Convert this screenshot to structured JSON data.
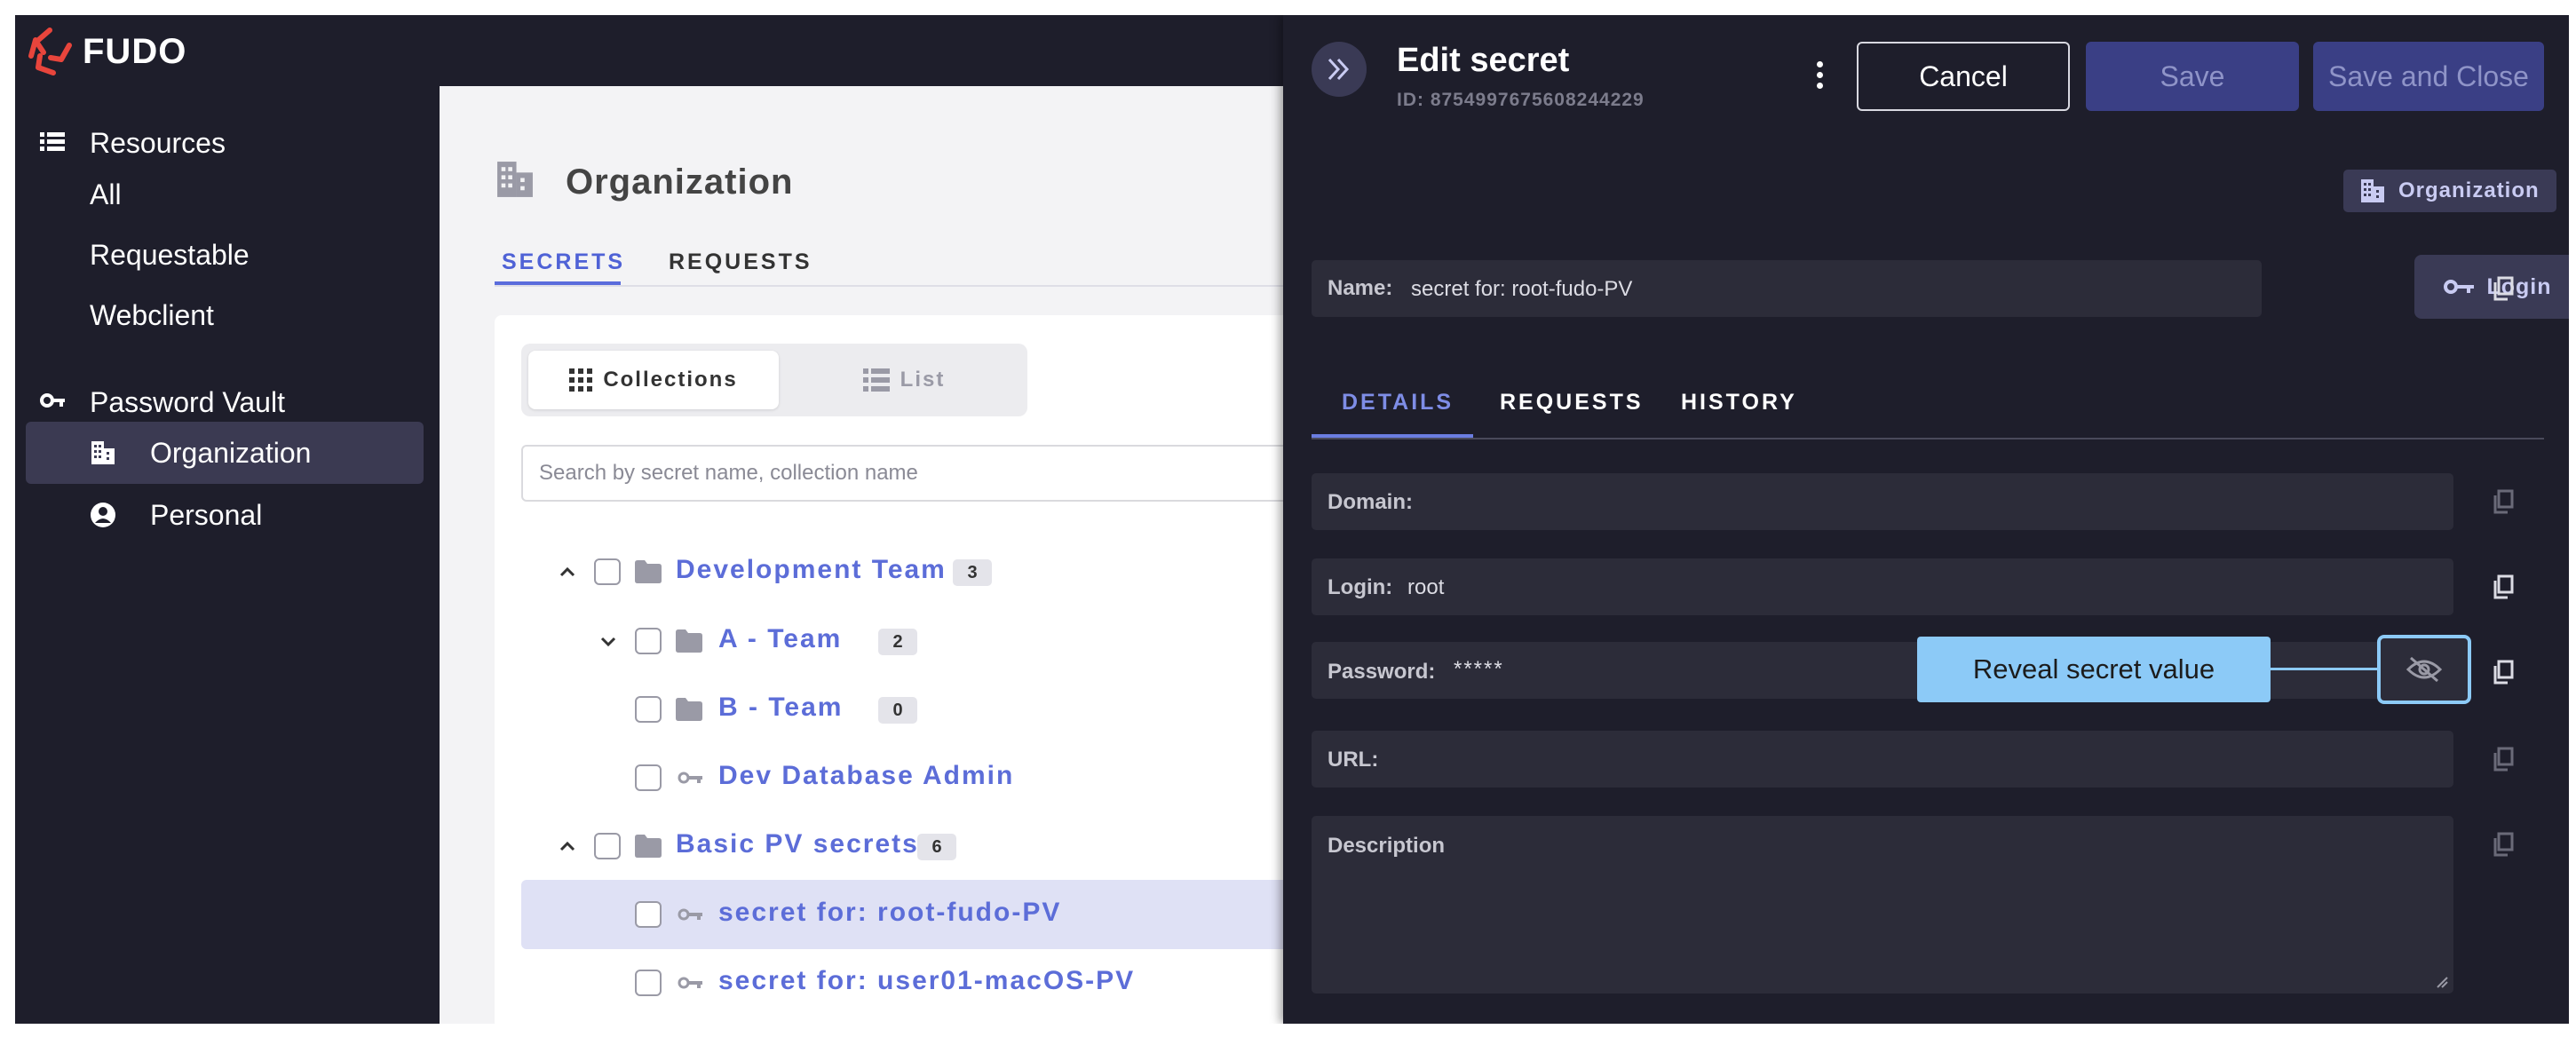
{
  "app": {
    "logo_text": "FUDO",
    "brand_color": "#e8453c"
  },
  "sidebar": {
    "resources_label": "Resources",
    "resources_items": [
      "All",
      "Requestable",
      "Webclient"
    ],
    "vault_label": "Password Vault",
    "vault_items": [
      {
        "label": "Organization",
        "icon": "building-icon",
        "active": true
      },
      {
        "label": "Personal",
        "icon": "user-circle-icon",
        "active": false
      }
    ]
  },
  "main": {
    "title": "Organization",
    "tabs": [
      {
        "label": "SECRETS",
        "active": true
      },
      {
        "label": "REQUESTS",
        "active": false
      }
    ],
    "view_toggle": {
      "collections_label": "Collections",
      "list_label": "List",
      "selected": "Collections"
    },
    "search": {
      "placeholder": "Search by secret name, collection name",
      "value": ""
    },
    "tree": [
      {
        "label": "Development Team",
        "type": "collection",
        "count": "3",
        "level": 0,
        "expanded": true
      },
      {
        "label": "A - Team",
        "type": "collection",
        "count": "2",
        "level": 1,
        "expanded": true
      },
      {
        "label": "B - Team",
        "type": "collection",
        "count": "0",
        "level": 1,
        "expanded": false
      },
      {
        "label": "Dev Database Admin",
        "type": "secret",
        "level": 1
      },
      {
        "label": "Basic PV secrets",
        "type": "collection",
        "count": "6",
        "level": 0,
        "expanded": true
      },
      {
        "label": "secret for: root-fudo-PV",
        "type": "secret",
        "level": 1,
        "selected": true
      },
      {
        "label": "secret for: user01-macOS-PV",
        "type": "secret",
        "level": 1
      }
    ]
  },
  "drawer": {
    "title": "Edit secret",
    "id_text": "ID: 8754997675608244229",
    "cancel_label": "Cancel",
    "save_label": "Save",
    "save_close_label": "Save and Close",
    "org_badge": "Organization",
    "name_label": "Name:",
    "name_value": "secret for: root-fudo-PV",
    "login_button_label": "Login",
    "tabs": [
      {
        "label": "DETAILS",
        "active": true
      },
      {
        "label": "REQUESTS",
        "active": false
      },
      {
        "label": "HISTORY",
        "active": false
      }
    ],
    "fields": {
      "domain_label": "Domain:",
      "domain_value": "",
      "login_label": "Login:",
      "login_value": "root",
      "password_label": "Password:",
      "password_value": "*****",
      "url_label": "URL:",
      "url_value": "",
      "description_label": "Description",
      "description_value": ""
    },
    "tooltip_text": "Reveal secret value",
    "highlight_color": "#8ccaf7",
    "accent_color": "#5c6dd8"
  }
}
